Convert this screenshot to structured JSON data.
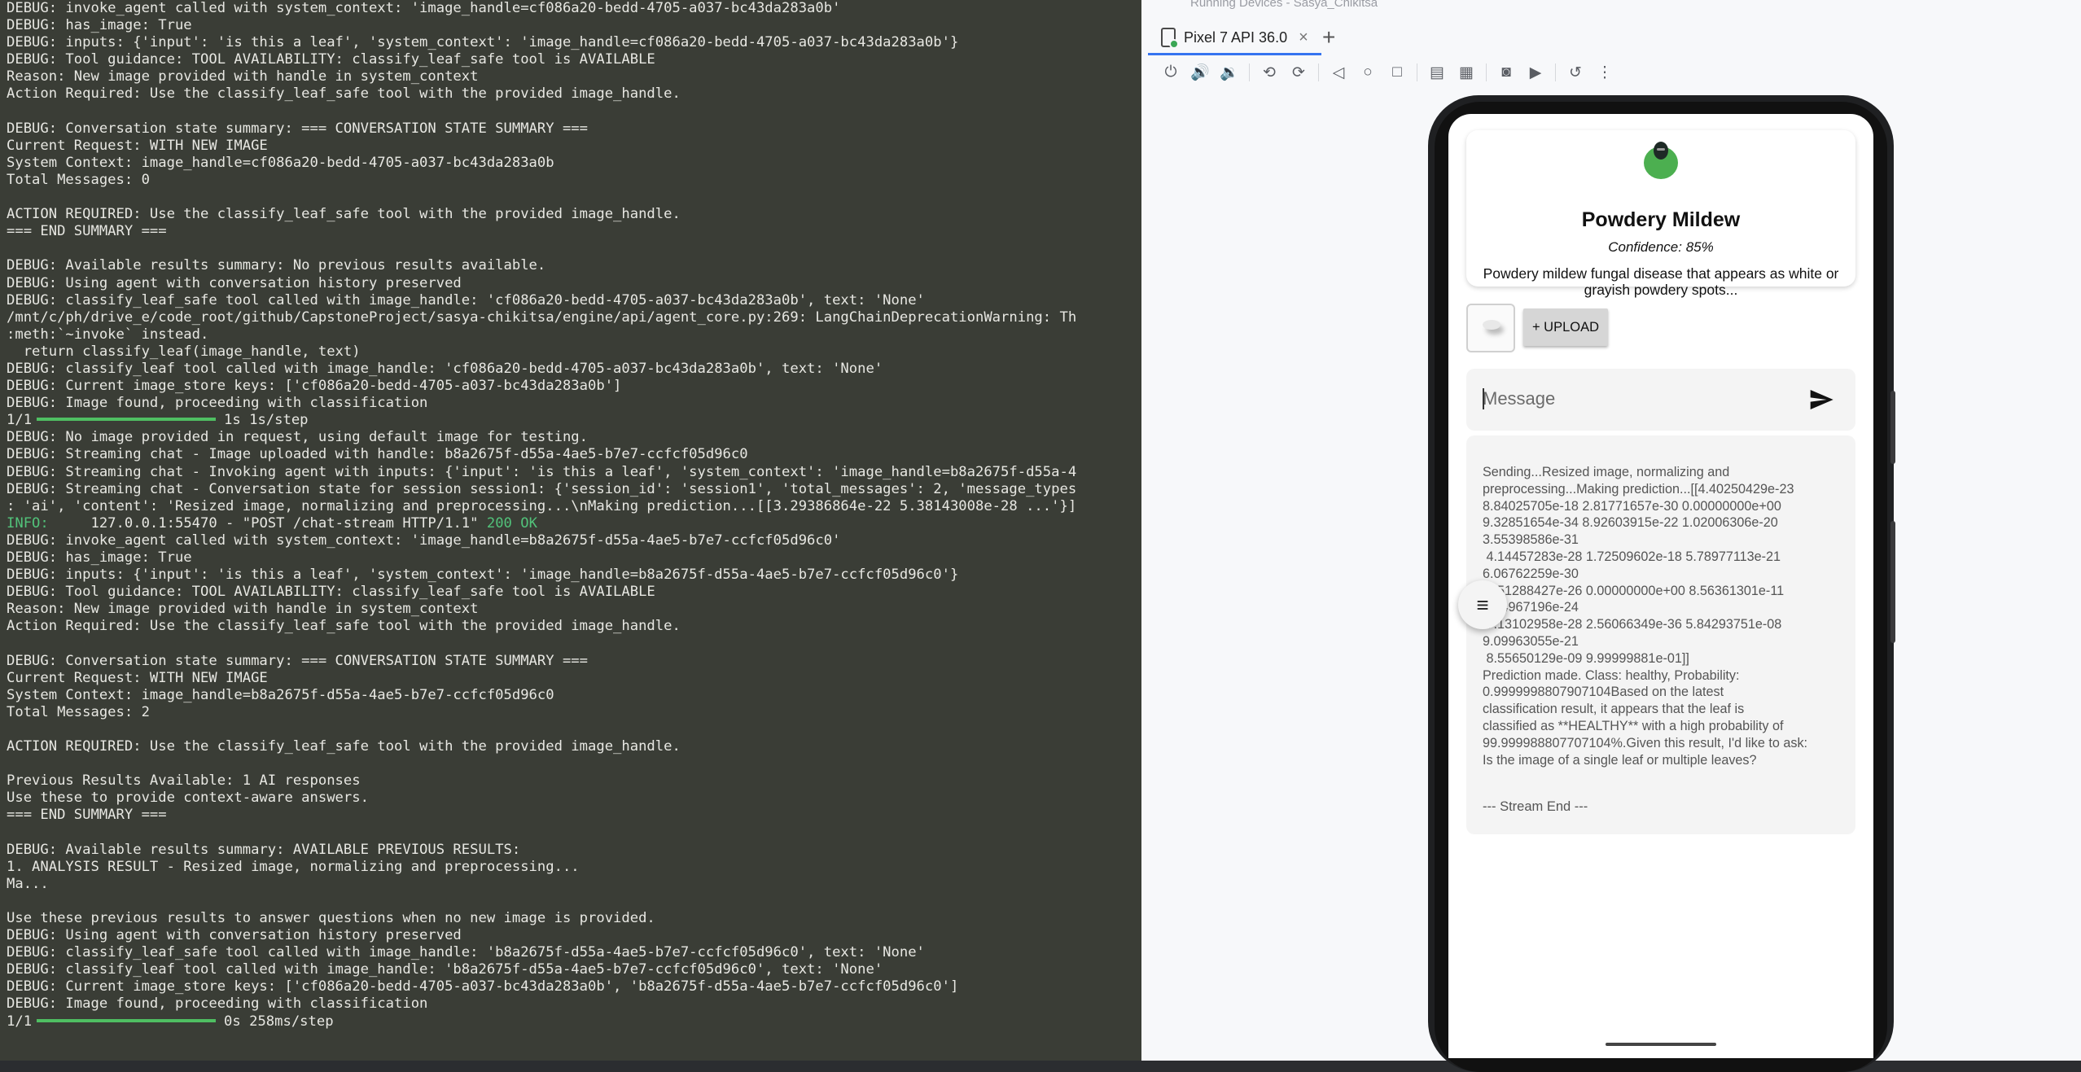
{
  "terminal": {
    "lines": [
      "DEBUG: invoke_agent called with system_context: 'image_handle=cf086a20-bedd-4705-a037-bc43da283a0b'",
      "DEBUG: has_image: True",
      "DEBUG: inputs: {'input': 'is this a leaf', 'system_context': 'image_handle=cf086a20-bedd-4705-a037-bc43da283a0b'}",
      "DEBUG: Tool guidance: TOOL AVAILABILITY: classify_leaf_safe tool is AVAILABLE",
      "Reason: New image provided with handle in system_context",
      "Action Required: Use the classify_leaf_safe tool with the provided image_handle.",
      "",
      "DEBUG: Conversation state summary: === CONVERSATION STATE SUMMARY ===",
      "Current Request: WITH NEW IMAGE",
      "System Context: image_handle=cf086a20-bedd-4705-a037-bc43da283a0b",
      "Total Messages: 0",
      "",
      "ACTION REQUIRED: Use the classify_leaf_safe tool with the provided image_handle.",
      "=== END SUMMARY ===",
      "",
      "DEBUG: Available results summary: No previous results available.",
      "DEBUG: Using agent with conversation history preserved",
      "DEBUG: classify_leaf_safe tool called with image_handle: 'cf086a20-bedd-4705-a037-bc43da283a0b', text: 'None'",
      "/mnt/c/ph/drive_e/code_root/github/CapstoneProject/sasya-chikitsa/engine/api/agent_core.py:269: LangChainDeprecationWarning: Th",
      ":meth:`~invoke` instead.",
      "  return classify_leaf(image_handle, text)",
      "DEBUG: classify_leaf tool called with image_handle: 'cf086a20-bedd-4705-a037-bc43da283a0b', text: 'None'",
      "DEBUG: Current image_store keys: ['cf086a20-bedd-4705-a037-bc43da283a0b']",
      "DEBUG: Image found, proceeding with classification",
      "1/1 ━━━ 1s 1s/step",
      "DEBUG: No image provided in request, using default image for testing.",
      "DEBUG: Streaming chat - Image uploaded with handle: b8a2675f-d55a-4ae5-b7e7-ccfcf05d96c0",
      "DEBUG: Streaming chat - Invoking agent with inputs: {'input': 'is this a leaf', 'system_context': 'image_handle=b8a2675f-d55a-4",
      "DEBUG: Streaming chat - Conversation state for session session1: {'session_id': 'session1', 'total_messages': 2, 'message_types",
      ": 'ai', 'content': 'Resized image, normalizing and preprocessing...\\nMaking prediction...[[3.29386864e-22 5.38143008e-28 ...'}]",
      "INFO:     127.0.0.1:55470 - \"POST /chat-stream HTTP/1.1\" 200 OK",
      "DEBUG: invoke_agent called with system_context: 'image_handle=b8a2675f-d55a-4ae5-b7e7-ccfcf05d96c0'",
      "DEBUG: has_image: True",
      "DEBUG: inputs: {'input': 'is this a leaf', 'system_context': 'image_handle=b8a2675f-d55a-4ae5-b7e7-ccfcf05d96c0'}",
      "DEBUG: Tool guidance: TOOL AVAILABILITY: classify_leaf_safe tool is AVAILABLE",
      "Reason: New image provided with handle in system_context",
      "Action Required: Use the classify_leaf_safe tool with the provided image_handle.",
      "",
      "DEBUG: Conversation state summary: === CONVERSATION STATE SUMMARY ===",
      "Current Request: WITH NEW IMAGE",
      "System Context: image_handle=b8a2675f-d55a-4ae5-b7e7-ccfcf05d96c0",
      "Total Messages: 2",
      "",
      "ACTION REQUIRED: Use the classify_leaf_safe tool with the provided image_handle.",
      "",
      "Previous Results Available: 1 AI responses",
      "Use these to provide context-aware answers.",
      "=== END SUMMARY ===",
      "",
      "DEBUG: Available results summary: AVAILABLE PREVIOUS RESULTS:",
      "1. ANALYSIS RESULT - Resized image, normalizing and preprocessing...",
      "Ma...",
      "",
      "Use these previous results to answer questions when no new image is provided.",
      "DEBUG: Using agent with conversation history preserved",
      "DEBUG: classify_leaf_safe tool called with image_handle: 'b8a2675f-d55a-4ae5-b7e7-ccfcf05d96c0', text: 'None'",
      "DEBUG: classify_leaf tool called with image_handle: 'b8a2675f-d55a-4ae5-b7e7-ccfcf05d96c0', text: 'None'",
      "DEBUG: Current image_store keys: ['cf086a20-bedd-4705-a037-bc43da283a0b', 'b8a2675f-d55a-4ae5-b7e7-ccfcf05d96c0']",
      "DEBUG: Image found, proceeding with classification",
      "1/1 ━━━ 0s 258ms/step"
    ],
    "progress_1": {
      "prefix": "1/1",
      "suffix": "1s 1s/step"
    },
    "progress_2": {
      "prefix": "1/1",
      "suffix": "0s 258ms/step"
    },
    "info_line": {
      "level": "INFO:",
      "body": "     127.0.0.1:55470 - \"POST /chat-stream HTTP/1.1\" ",
      "status": "200 OK"
    }
  },
  "ide": {
    "window_title": "Running Devices - Sasya_Chikitsa",
    "device_tab_label": "Pixel 7 API 36.0",
    "toolbar_icons": [
      "power-icon",
      "volume-up-icon",
      "volume-down-icon",
      "rotate-left-icon",
      "rotate-right-icon",
      "back-icon",
      "home-icon",
      "overview-icon",
      "snapshot-icon",
      "display-settings-icon",
      "camera-icon",
      "screen-record-icon",
      "reset-icon",
      "more-icon"
    ]
  },
  "app": {
    "result": {
      "title": "Powdery Mildew",
      "confidence": "Confidence: 85%",
      "description": "Powdery mildew fungal disease that appears as white or grayish powdery spots..."
    },
    "upload_label": "+ UPLOAD",
    "message_placeholder": "Message",
    "stream_text": "Sending...Resized image, normalizing and preprocessing...Making prediction...[[4.40250429e-23\n8.84025705e-18 2.81771657e-30 0.00000000e+00\n9.32851654e-34 8.92603915e-22 1.02006306e-20\n3.55398586e-31\n 4.14457283e-28 1.72509602e-18 5.78977113e-21\n6.06762259e-30\n 1.51288427e-26 0.00000000e+00 8.56361301e-11\n3.14967196e-24\n 7.13102958e-28 2.56066349e-36 5.84293751e-08\n9.09963055e-21\n 8.55650129e-09 9.99999881e-01]]\nPrediction made. Class: healthy, Probability:\n0.9999998807907104Based on the latest\nclassification result, it appears that the leaf is\nclassified as **HEALTHY** with a high probability of\n99.999988807707104%.Given this result, I'd like to ask:\nIs the image of a single leaf or multiple leaves?",
    "stream_end": "--- Stream End ---"
  },
  "colors": {
    "terminal_bg": "#3a3d36",
    "terminal_fg": "#e7e7e2",
    "progress_green": "#4fbf62",
    "info_green": "#52c27a",
    "leaf_green": "#4caf50",
    "tab_accent": "#3574f0"
  }
}
